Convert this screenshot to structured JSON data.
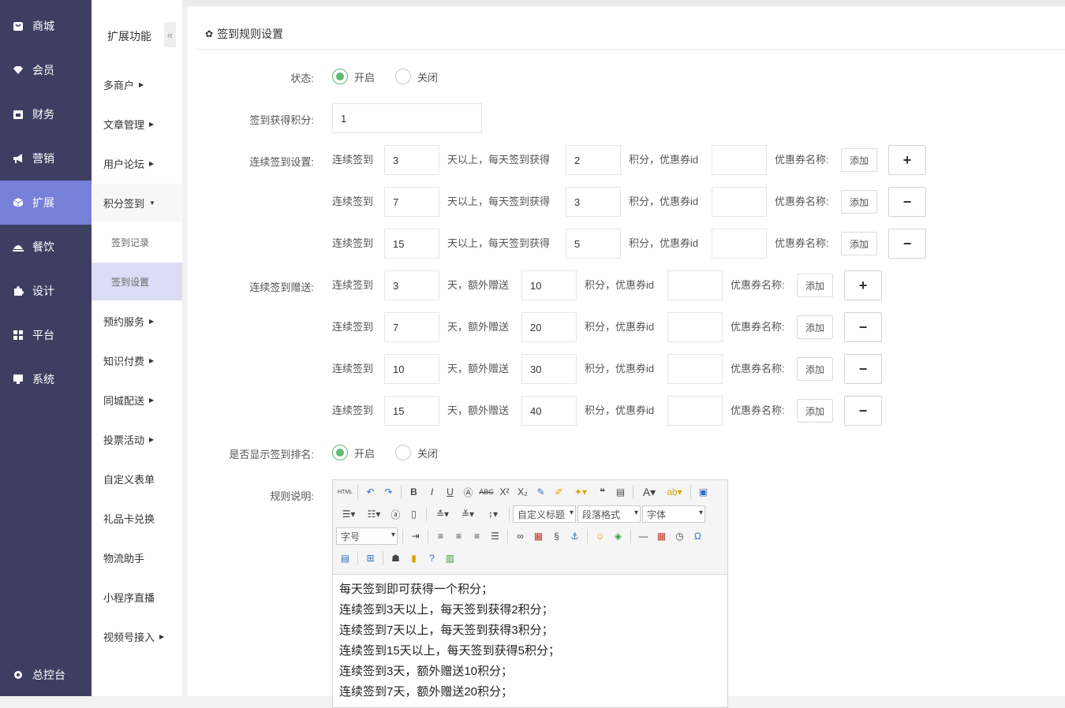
{
  "nav1": {
    "items": [
      {
        "label": "商城",
        "icon": "shop-icon"
      },
      {
        "label": "会员",
        "icon": "diamond-icon"
      },
      {
        "label": "财务",
        "icon": "wallet-icon"
      },
      {
        "label": "营销",
        "icon": "megaphone-icon"
      },
      {
        "label": "扩展",
        "icon": "cube-icon"
      },
      {
        "label": "餐饮",
        "icon": "dish-icon"
      },
      {
        "label": "设计",
        "icon": "puzzle-icon"
      },
      {
        "label": "平台",
        "icon": "grid-icon"
      },
      {
        "label": "系统",
        "icon": "monitor-icon"
      }
    ],
    "active": "扩展",
    "bottom": {
      "label": "总控台",
      "icon": "gear-icon"
    }
  },
  "nav2": {
    "title": "扩展功能",
    "collapse": "«",
    "items": [
      {
        "label": "多商户"
      },
      {
        "label": "文章管理"
      },
      {
        "label": "用户论坛"
      },
      {
        "label": "积分签到"
      },
      {
        "label": "签到记录"
      },
      {
        "label": "签到设置"
      },
      {
        "label": "预约服务"
      },
      {
        "label": "知识付费"
      },
      {
        "label": "同城配送"
      },
      {
        "label": "投票活动"
      },
      {
        "label": "自定义表单"
      },
      {
        "label": "礼品卡兑换"
      },
      {
        "label": "物流助手"
      },
      {
        "label": "小程序直播"
      },
      {
        "label": "视频号接入"
      }
    ]
  },
  "panel": {
    "title": "签到规则设置"
  },
  "form": {
    "status_label": "状态:",
    "on": "开启",
    "off": "关闭",
    "points_label": "签到获得积分:",
    "points_value": "1",
    "consecutive_label": "连续签到设置:",
    "gift_label": "连续签到赠送:",
    "rank_label": "是否显示签到排名:",
    "rules_label": "规则说明:",
    "txt_consecutive": "连续签到",
    "txt_days_above": "天以上，每天签到获得",
    "txt_points_coupon": "积分，优惠券id",
    "txt_coupon_name": "优惠券名称:",
    "txt_add": "添加",
    "txt_days_extra": "天，额外赠送",
    "plus": "+",
    "minus": "−",
    "consecutive_rows": [
      {
        "days": "3",
        "points": "2",
        "coupon_id": ""
      },
      {
        "days": "7",
        "points": "3",
        "coupon_id": ""
      },
      {
        "days": "15",
        "points": "5",
        "coupon_id": ""
      }
    ],
    "gift_rows": [
      {
        "days": "3",
        "points": "10",
        "coupon_id": ""
      },
      {
        "days": "7",
        "points": "20",
        "coupon_id": ""
      },
      {
        "days": "10",
        "points": "30",
        "coupon_id": ""
      },
      {
        "days": "15",
        "points": "40",
        "coupon_id": ""
      }
    ]
  },
  "editor": {
    "selects": {
      "custom_title": "自定义标题",
      "paragraph": "段落格式",
      "font": "字体",
      "size": "字号"
    },
    "content_lines": [
      "每天签到即可获得一个积分；",
      "连续签到3天以上，每天签到获得2积分；",
      "连续签到7天以上，每天签到获得3积分；",
      "连续签到15天以上，每天签到获得5积分；",
      "连续签到3天，额外赠送10积分；",
      "连续签到7天，额外赠送20积分；"
    ]
  }
}
